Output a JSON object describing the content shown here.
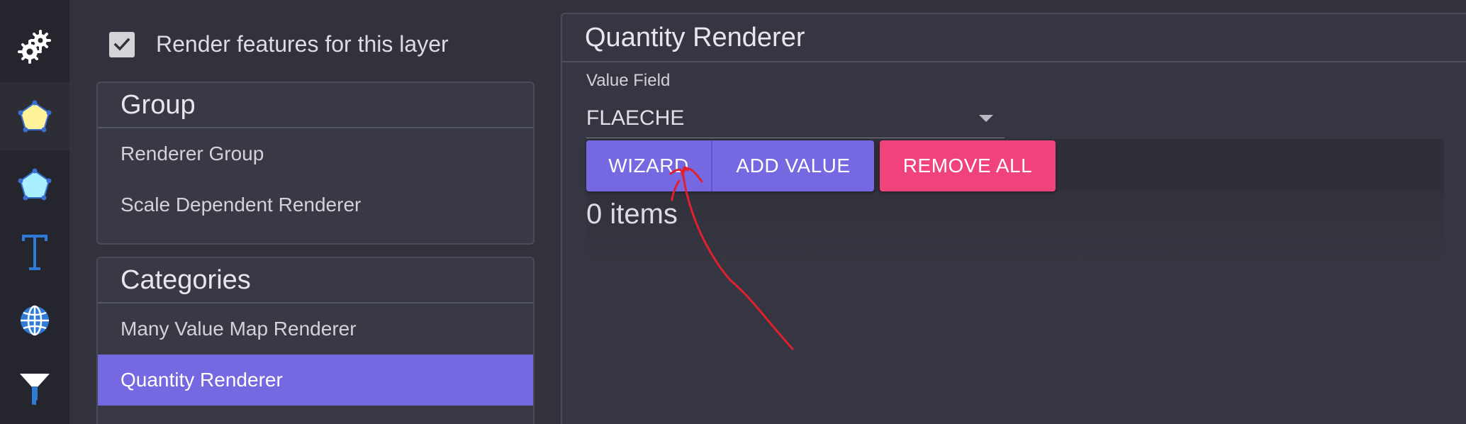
{
  "sidebar": {
    "icons": [
      {
        "name": "gears-icon"
      },
      {
        "name": "polygon-yellow-icon"
      },
      {
        "name": "polygon-cyan-icon"
      },
      {
        "name": "text-icon"
      },
      {
        "name": "globe-icon"
      },
      {
        "name": "filter-icon"
      }
    ]
  },
  "render_checkbox": {
    "label": "Render features for this layer",
    "checked": true
  },
  "group_panel": {
    "title": "Group",
    "items": [
      "Renderer Group",
      "Scale Dependent Renderer"
    ]
  },
  "categories_panel": {
    "title": "Categories",
    "items": [
      "Many Value Map Renderer",
      "Quantity Renderer"
    ],
    "selected": "Quantity Renderer"
  },
  "quantity_renderer": {
    "title": "Quantity Renderer",
    "value_field_label": "Value Field",
    "value_field_value": "FLAECHE",
    "buttons": {
      "wizard": "WIZARD",
      "add_value": "ADD VALUE",
      "remove_all": "REMOVE ALL"
    },
    "items_count": "0 items"
  },
  "colors": {
    "accent": "#7569e1",
    "danger": "#f0427b",
    "annotation": "#e0202e"
  }
}
